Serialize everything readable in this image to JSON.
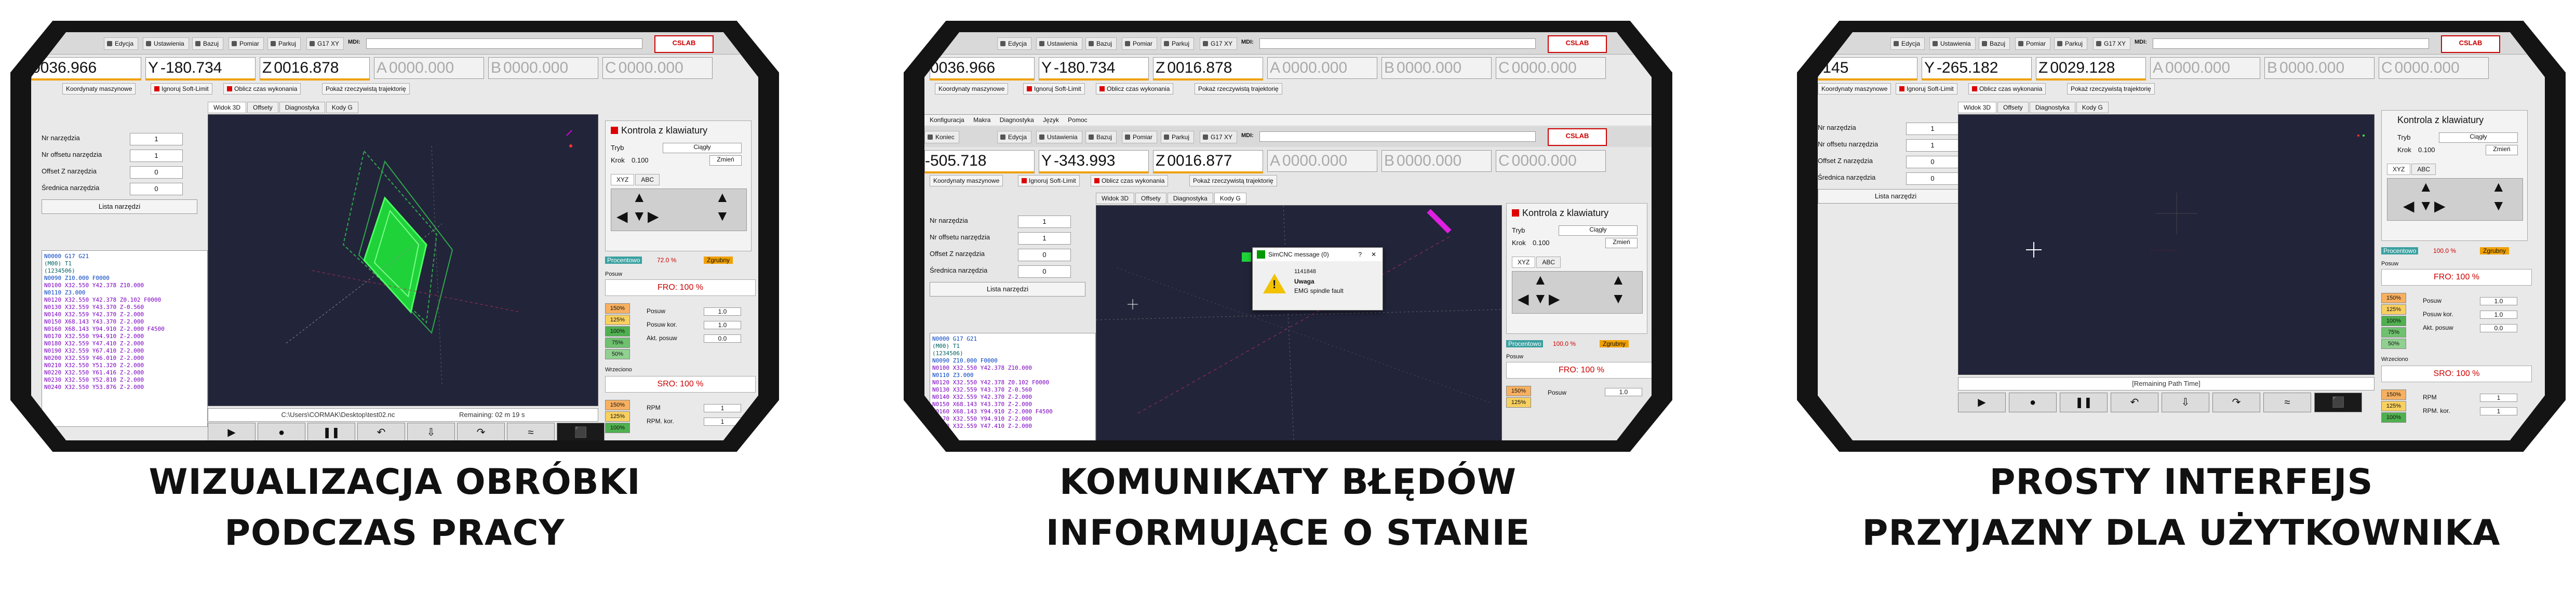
{
  "common": {
    "toolbar": [
      "Edycja",
      "Ustawienia",
      "Bazuj",
      "Pomiar",
      "Parkuj",
      "G17 XY"
    ],
    "mdi_label": "MDI:",
    "logo": "CSLAB",
    "flags": [
      "Koordynaty maszynowe",
      "Ignoruj Soft-Limit",
      "Oblicz czas wykonania",
      "Pokaż rzeczywistą trajektorię"
    ],
    "left_fields": [
      {
        "label": "Nr narzędzia",
        "value": "1"
      },
      {
        "label": "Nr offsetu narzędzia",
        "value": "1"
      },
      {
        "label": "Offset Z narzędzia",
        "value": "0"
      },
      {
        "label": "Średnica narzędzia",
        "value": "0"
      }
    ],
    "tool_list_btn": "Lista narzędzi",
    "tabs": [
      "Widok 3D",
      "Offsety",
      "Diagnostyka",
      "Kody G"
    ],
    "jog_title": "Kontrola z klawiatury",
    "mode_label": "Tryb",
    "mode_value": "Ciągły",
    "step_label": "Krok",
    "step_value": "0.100",
    "change_btn": "Zmień",
    "axis_tabs": [
      "XYZ",
      "ABC"
    ],
    "feed_pct": "100.0 %",
    "feed_label": "Posuw",
    "feed_mode_a": "Procentowo",
    "feed_mode_b": "Zgrubny",
    "fro": "FRO: 100 %",
    "sro": "SRO: 100 %",
    "pct_buttons": [
      "150%",
      "125%",
      "100%",
      "75%",
      "50%"
    ],
    "feed_rows": [
      {
        "label": "Posuw",
        "value": "1.0"
      },
      {
        "label": "Posuw kor.",
        "value": "1.0"
      },
      {
        "label": "Akt. posuw",
        "value": "0.0"
      }
    ],
    "spindle_label": "Wrzeciono",
    "spindle_rows": [
      {
        "label": "RPM",
        "value": "1"
      },
      {
        "label": "RPM. kor.",
        "value": "1"
      }
    ],
    "gcode_lines": [
      "N0000 G17 G21",
      "(M00) T1",
      "(1234506)",
      "N0090 Z10.000 F0000",
      "N0100 X32.550 Y42.378 Z10.000",
      "N0110 Z3.000",
      "N0120 X32.550 Y42.378 Z0.102 F0000",
      "N0130 X32.559 Y43.370 Z-0.560",
      "N0140 X32.559 Y42.370 Z-2.000",
      "N0150 X68.143 Y43.370 Z-2.000",
      "N0160 X68.143 Y94.910 Z-2.000 F4500",
      "N0170 X32.550 Y94.910 Z-2.000",
      "N0180 X32.559 Y47.410 Z-2.000",
      "N0190 X32.559 Y67.410 Z-2.000",
      "N0200 X32.559 Y46.010 Z-2.000",
      "N0210 X32.550 Y51.320 Z-2.000",
      "N0220 X32.550 Y61.416 Z-2.000",
      "N0230 X32.550 Y52.810 Z-2.000",
      "N0240 X32.550 Y53.876 Z-2.000"
    ]
  },
  "panels": [
    {
      "caption_lines": [
        "WIZUALIZACJA OBRÓBKI",
        "PODCZAS PRACY"
      ],
      "coords": {
        "x": "0036.966",
        "y": "-180.734",
        "z": "0016.878",
        "a": "0000.000",
        "b": "0000.000",
        "c": "0000.000"
      },
      "file_path": "C:\\Users\\CORMAK\\Desktop\\test02.nc",
      "time_remaining": "Remaining: 02 m 19 s",
      "feed_pct": "72.0 %"
    },
    {
      "caption_lines": [
        "KOMUNIKATY BŁĘDÓW",
        "INFORMUJĄCE O STANIE"
      ],
      "coords": {
        "x": "0036.966",
        "y": "-180.734",
        "z": "0016.878",
        "a": "0000.000",
        "b": "0000.000",
        "c": "0000.000"
      },
      "coords_inner": {
        "x": "-505.718",
        "y": "-343.993",
        "z": "0016.877",
        "a": "0000.000",
        "b": "0000.000",
        "c": "0000.000"
      },
      "menu": [
        "Konfiguracja",
        "Makra",
        "Diagnostyka",
        "Język",
        "Pomoc"
      ],
      "dialog": {
        "title": "SimCNC message (0)",
        "code": "1141848",
        "head": "Uwaga",
        "text": "EMG spindle fault"
      }
    },
    {
      "caption_lines": [
        "PROSTY INTERFEJS",
        "PRZYJAZNY DLA UŻYTKOWNIKA"
      ],
      "coords": {
        "x": ".145",
        "y": "-265.182",
        "z": "0029.128",
        "a": "0000.000",
        "b": "0000.000",
        "c": "0000.000"
      },
      "time_remaining": "[Remaining Path Time]"
    }
  ]
}
